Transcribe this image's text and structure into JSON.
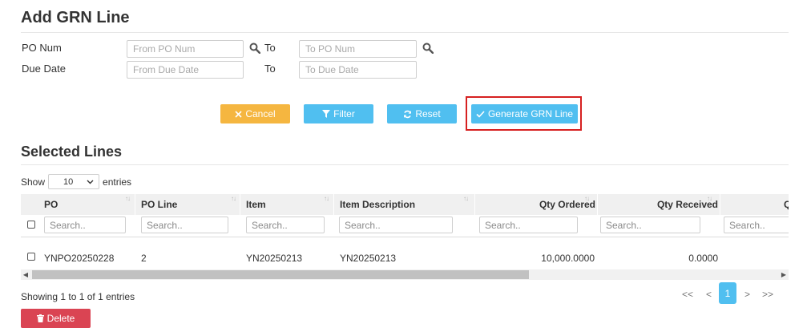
{
  "form": {
    "title": "Add GRN Line",
    "po_num_label": "PO Num",
    "due_date_label": "Due Date",
    "to_label": "To",
    "from_po_placeholder": "From PO Num",
    "to_po_placeholder": "To PO Num",
    "from_due_placeholder": "From Due Date",
    "to_due_placeholder": "To Due Date",
    "search_icon": "magnifier-icon"
  },
  "buttons": {
    "cancel": "Cancel",
    "filter": "Filter",
    "reset": "Reset",
    "generate": "Generate GRN Line",
    "delete": "Delete"
  },
  "colors": {
    "cancel": "#f5b640",
    "primary": "#50bff0",
    "danger": "#da4453",
    "highlight_box": "#d62020"
  },
  "lines": {
    "title": "Selected Lines",
    "show_label": "Show",
    "entries_label": "entries",
    "page_size": "10",
    "columns": [
      "PO",
      "PO Line",
      "Item",
      "Item Description",
      "Qty Ordered",
      "Qty Received",
      "Q"
    ],
    "search_placeholder": "Search..",
    "rows": [
      {
        "po": "YNPO20250228",
        "po_line": "2",
        "item": "YN20250213",
        "item_desc": "YN20250213",
        "qty_ordered": "10,000.0000",
        "qty_received": "0.0000"
      }
    ],
    "info": "Showing 1 to 1 of 1 entries",
    "pager": {
      "first": "<<",
      "prev": "<",
      "current": "1",
      "next": ">",
      "last": ">>"
    }
  }
}
